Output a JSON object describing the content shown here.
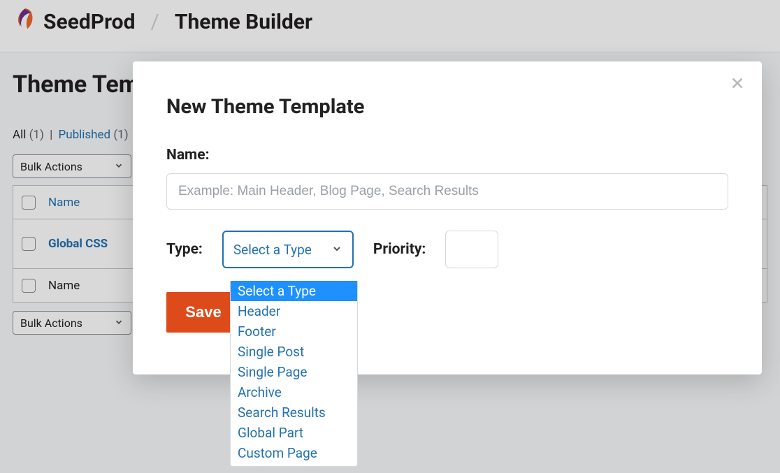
{
  "header": {
    "brand": "SeedProd",
    "page_title": "Theme Builder"
  },
  "main": {
    "heading": "Theme Templates",
    "filters": {
      "all_label": "All",
      "all_count": "(1)",
      "pipe": "|",
      "published_label": "Published",
      "published_count": "(1)"
    },
    "bulk_actions": "Bulk Actions",
    "table": {
      "col_name": "Name",
      "row_name": "Global CSS"
    }
  },
  "modal": {
    "title": "New Theme Template",
    "name_label": "Name:",
    "name_placeholder": "Example: Main Header, Blog Page, Search Results",
    "type_label": "Type:",
    "type_selected": "Select a Type",
    "priority_label": "Priority:",
    "save_label": "Save",
    "type_options": [
      "Select a Type",
      "Header",
      "Footer",
      "Single Post",
      "Single Page",
      "Archive",
      "Search Results",
      "Global Part",
      "Custom Page"
    ]
  }
}
